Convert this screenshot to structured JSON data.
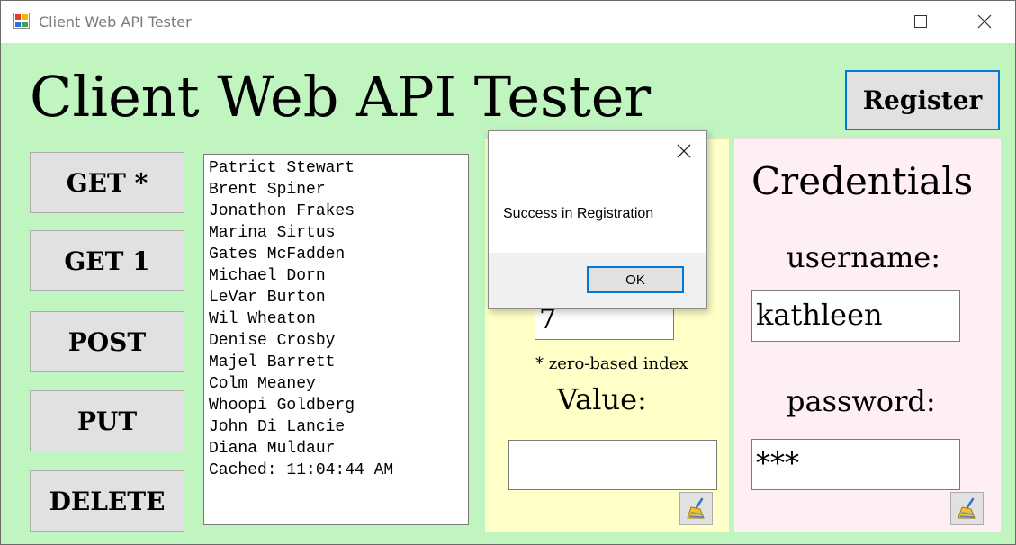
{
  "window": {
    "title": "Client Web API Tester"
  },
  "app": {
    "heading": "Client Web API Tester",
    "register_label": "Register"
  },
  "actions": {
    "get_all": "GET *",
    "get_one": "GET 1",
    "post": "POST",
    "put": "PUT",
    "delete": "DELETE"
  },
  "results": {
    "lines": [
      "Patrict Stewart",
      "Brent Spiner",
      "Jonathon Frakes",
      "Marina Sirtus",
      "Gates McFadden",
      "Michael Dorn",
      "LeVar Burton",
      "Wil Wheaton",
      "Denise Crosby",
      "Majel Barrett",
      "Colm Meaney",
      "Whoopi Goldberg",
      "John Di Lancie",
      "Diana Muldaur",
      "Cached: 11:04:44 AM"
    ]
  },
  "item_panel": {
    "index_value": "7",
    "index_note": "* zero-based index",
    "value_label": "Value:",
    "value_text": ""
  },
  "credentials": {
    "heading": "Credentials",
    "username_label": "username:",
    "username_value": "kathleen",
    "password_label": "password:",
    "password_value": "***"
  },
  "dialog": {
    "message": "Success in Registration",
    "ok_label": "OK"
  },
  "icons": {
    "app": "app-icon",
    "minimize": "minimize-icon",
    "maximize": "maximize-icon",
    "close": "close-icon",
    "clear": "broom-icon",
    "dialog_close": "close-icon"
  },
  "colors": {
    "form_background": "#c0f5c0",
    "item_panel_background": "#ffffc8",
    "credentials_panel_background": "#ffeef2",
    "focus_border": "#0078d7",
    "button_face": "#e1e1e1"
  }
}
